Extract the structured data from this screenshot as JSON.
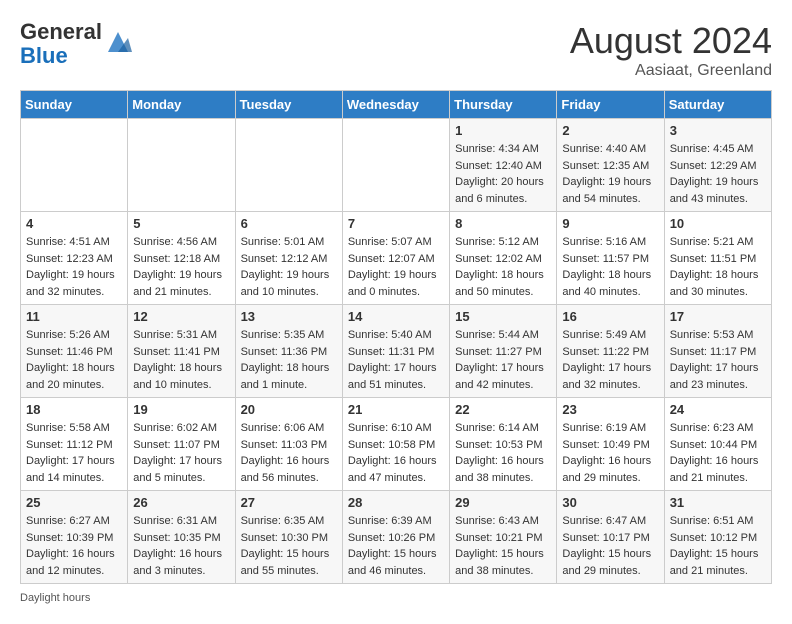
{
  "header": {
    "logo_general": "General",
    "logo_blue": "Blue",
    "month_title": "August 2024",
    "location": "Aasiaat, Greenland"
  },
  "days_of_week": [
    "Sunday",
    "Monday",
    "Tuesday",
    "Wednesday",
    "Thursday",
    "Friday",
    "Saturday"
  ],
  "weeks": [
    [
      {
        "day": "",
        "info": ""
      },
      {
        "day": "",
        "info": ""
      },
      {
        "day": "",
        "info": ""
      },
      {
        "day": "",
        "info": ""
      },
      {
        "day": "1",
        "info": "Sunrise: 4:34 AM\nSunset: 12:40 AM\nDaylight: 20 hours\nand 6 minutes."
      },
      {
        "day": "2",
        "info": "Sunrise: 4:40 AM\nSunset: 12:35 AM\nDaylight: 19 hours\nand 54 minutes."
      },
      {
        "day": "3",
        "info": "Sunrise: 4:45 AM\nSunset: 12:29 AM\nDaylight: 19 hours\nand 43 minutes."
      }
    ],
    [
      {
        "day": "4",
        "info": "Sunrise: 4:51 AM\nSunset: 12:23 AM\nDaylight: 19 hours\nand 32 minutes."
      },
      {
        "day": "5",
        "info": "Sunrise: 4:56 AM\nSunset: 12:18 AM\nDaylight: 19 hours\nand 21 minutes."
      },
      {
        "day": "6",
        "info": "Sunrise: 5:01 AM\nSunset: 12:12 AM\nDaylight: 19 hours\nand 10 minutes."
      },
      {
        "day": "7",
        "info": "Sunrise: 5:07 AM\nSunset: 12:07 AM\nDaylight: 19 hours\nand 0 minutes."
      },
      {
        "day": "8",
        "info": "Sunrise: 5:12 AM\nSunset: 12:02 AM\nDaylight: 18 hours\nand 50 minutes."
      },
      {
        "day": "9",
        "info": "Sunrise: 5:16 AM\nSunset: 11:57 PM\nDaylight: 18 hours\nand 40 minutes."
      },
      {
        "day": "10",
        "info": "Sunrise: 5:21 AM\nSunset: 11:51 PM\nDaylight: 18 hours\nand 30 minutes."
      }
    ],
    [
      {
        "day": "11",
        "info": "Sunrise: 5:26 AM\nSunset: 11:46 PM\nDaylight: 18 hours\nand 20 minutes."
      },
      {
        "day": "12",
        "info": "Sunrise: 5:31 AM\nSunset: 11:41 PM\nDaylight: 18 hours\nand 10 minutes."
      },
      {
        "day": "13",
        "info": "Sunrise: 5:35 AM\nSunset: 11:36 PM\nDaylight: 18 hours\nand 1 minute."
      },
      {
        "day": "14",
        "info": "Sunrise: 5:40 AM\nSunset: 11:31 PM\nDaylight: 17 hours\nand 51 minutes."
      },
      {
        "day": "15",
        "info": "Sunrise: 5:44 AM\nSunset: 11:27 PM\nDaylight: 17 hours\nand 42 minutes."
      },
      {
        "day": "16",
        "info": "Sunrise: 5:49 AM\nSunset: 11:22 PM\nDaylight: 17 hours\nand 32 minutes."
      },
      {
        "day": "17",
        "info": "Sunrise: 5:53 AM\nSunset: 11:17 PM\nDaylight: 17 hours\nand 23 minutes."
      }
    ],
    [
      {
        "day": "18",
        "info": "Sunrise: 5:58 AM\nSunset: 11:12 PM\nDaylight: 17 hours\nand 14 minutes."
      },
      {
        "day": "19",
        "info": "Sunrise: 6:02 AM\nSunset: 11:07 PM\nDaylight: 17 hours\nand 5 minutes."
      },
      {
        "day": "20",
        "info": "Sunrise: 6:06 AM\nSunset: 11:03 PM\nDaylight: 16 hours\nand 56 minutes."
      },
      {
        "day": "21",
        "info": "Sunrise: 6:10 AM\nSunset: 10:58 PM\nDaylight: 16 hours\nand 47 minutes."
      },
      {
        "day": "22",
        "info": "Sunrise: 6:14 AM\nSunset: 10:53 PM\nDaylight: 16 hours\nand 38 minutes."
      },
      {
        "day": "23",
        "info": "Sunrise: 6:19 AM\nSunset: 10:49 PM\nDaylight: 16 hours\nand 29 minutes."
      },
      {
        "day": "24",
        "info": "Sunrise: 6:23 AM\nSunset: 10:44 PM\nDaylight: 16 hours\nand 21 minutes."
      }
    ],
    [
      {
        "day": "25",
        "info": "Sunrise: 6:27 AM\nSunset: 10:39 PM\nDaylight: 16 hours\nand 12 minutes."
      },
      {
        "day": "26",
        "info": "Sunrise: 6:31 AM\nSunset: 10:35 PM\nDaylight: 16 hours\nand 3 minutes."
      },
      {
        "day": "27",
        "info": "Sunrise: 6:35 AM\nSunset: 10:30 PM\nDaylight: 15 hours\nand 55 minutes."
      },
      {
        "day": "28",
        "info": "Sunrise: 6:39 AM\nSunset: 10:26 PM\nDaylight: 15 hours\nand 46 minutes."
      },
      {
        "day": "29",
        "info": "Sunrise: 6:43 AM\nSunset: 10:21 PM\nDaylight: 15 hours\nand 38 minutes."
      },
      {
        "day": "30",
        "info": "Sunrise: 6:47 AM\nSunset: 10:17 PM\nDaylight: 15 hours\nand 29 minutes."
      },
      {
        "day": "31",
        "info": "Sunrise: 6:51 AM\nSunset: 10:12 PM\nDaylight: 15 hours\nand 21 minutes."
      }
    ]
  ],
  "footer": {
    "daylight_label": "Daylight hours"
  }
}
